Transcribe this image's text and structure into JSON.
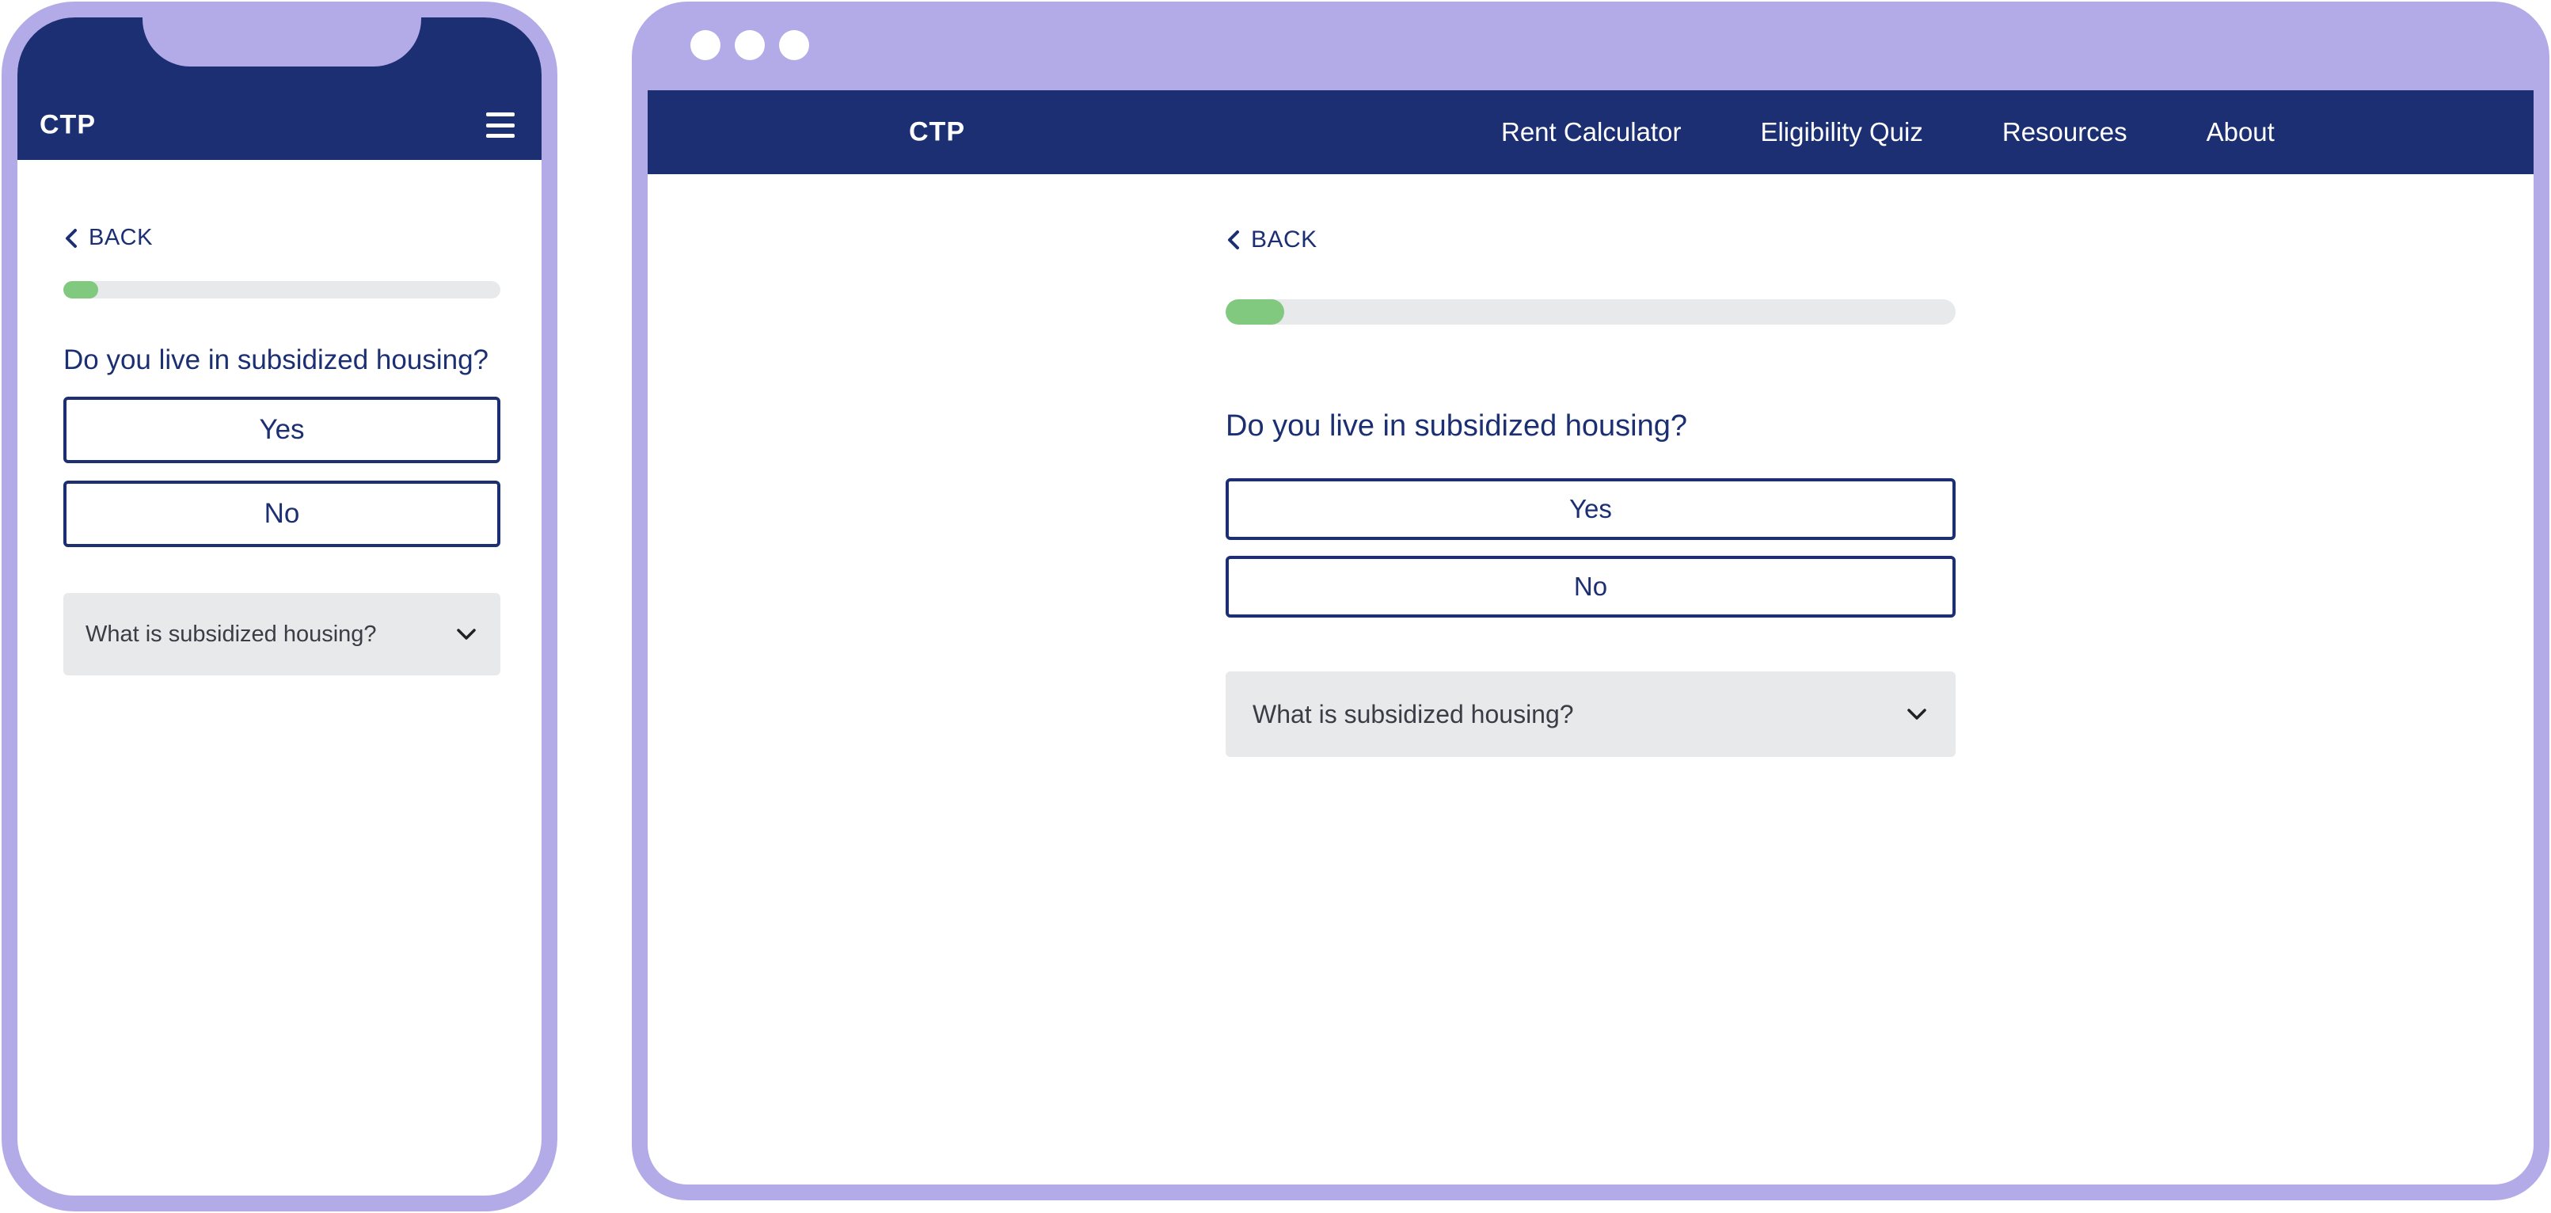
{
  "brand": {
    "logo_text": "CTP"
  },
  "nav": {
    "links": [
      "Rent Calculator",
      "Eligibility Quiz",
      "Resources",
      "About"
    ]
  },
  "quiz": {
    "back_label": "BACK",
    "progress": 0.08,
    "question": "Do you live in subsidized housing?",
    "answers": [
      "Yes",
      "No"
    ],
    "help_accordion_label": "What is subsidized housing?"
  },
  "icons": {
    "menu": "hamburger-menu-icon",
    "back": "chevron-left-icon",
    "accordion": "chevron-down-icon"
  },
  "colors": {
    "frame": "#b3aae8",
    "header": "#1b2f72",
    "primary_text": "#1b2f72",
    "progress_fill": "#80c97e",
    "progress_track": "#e8e9eb",
    "accordion_bg": "#e8e9eb"
  }
}
